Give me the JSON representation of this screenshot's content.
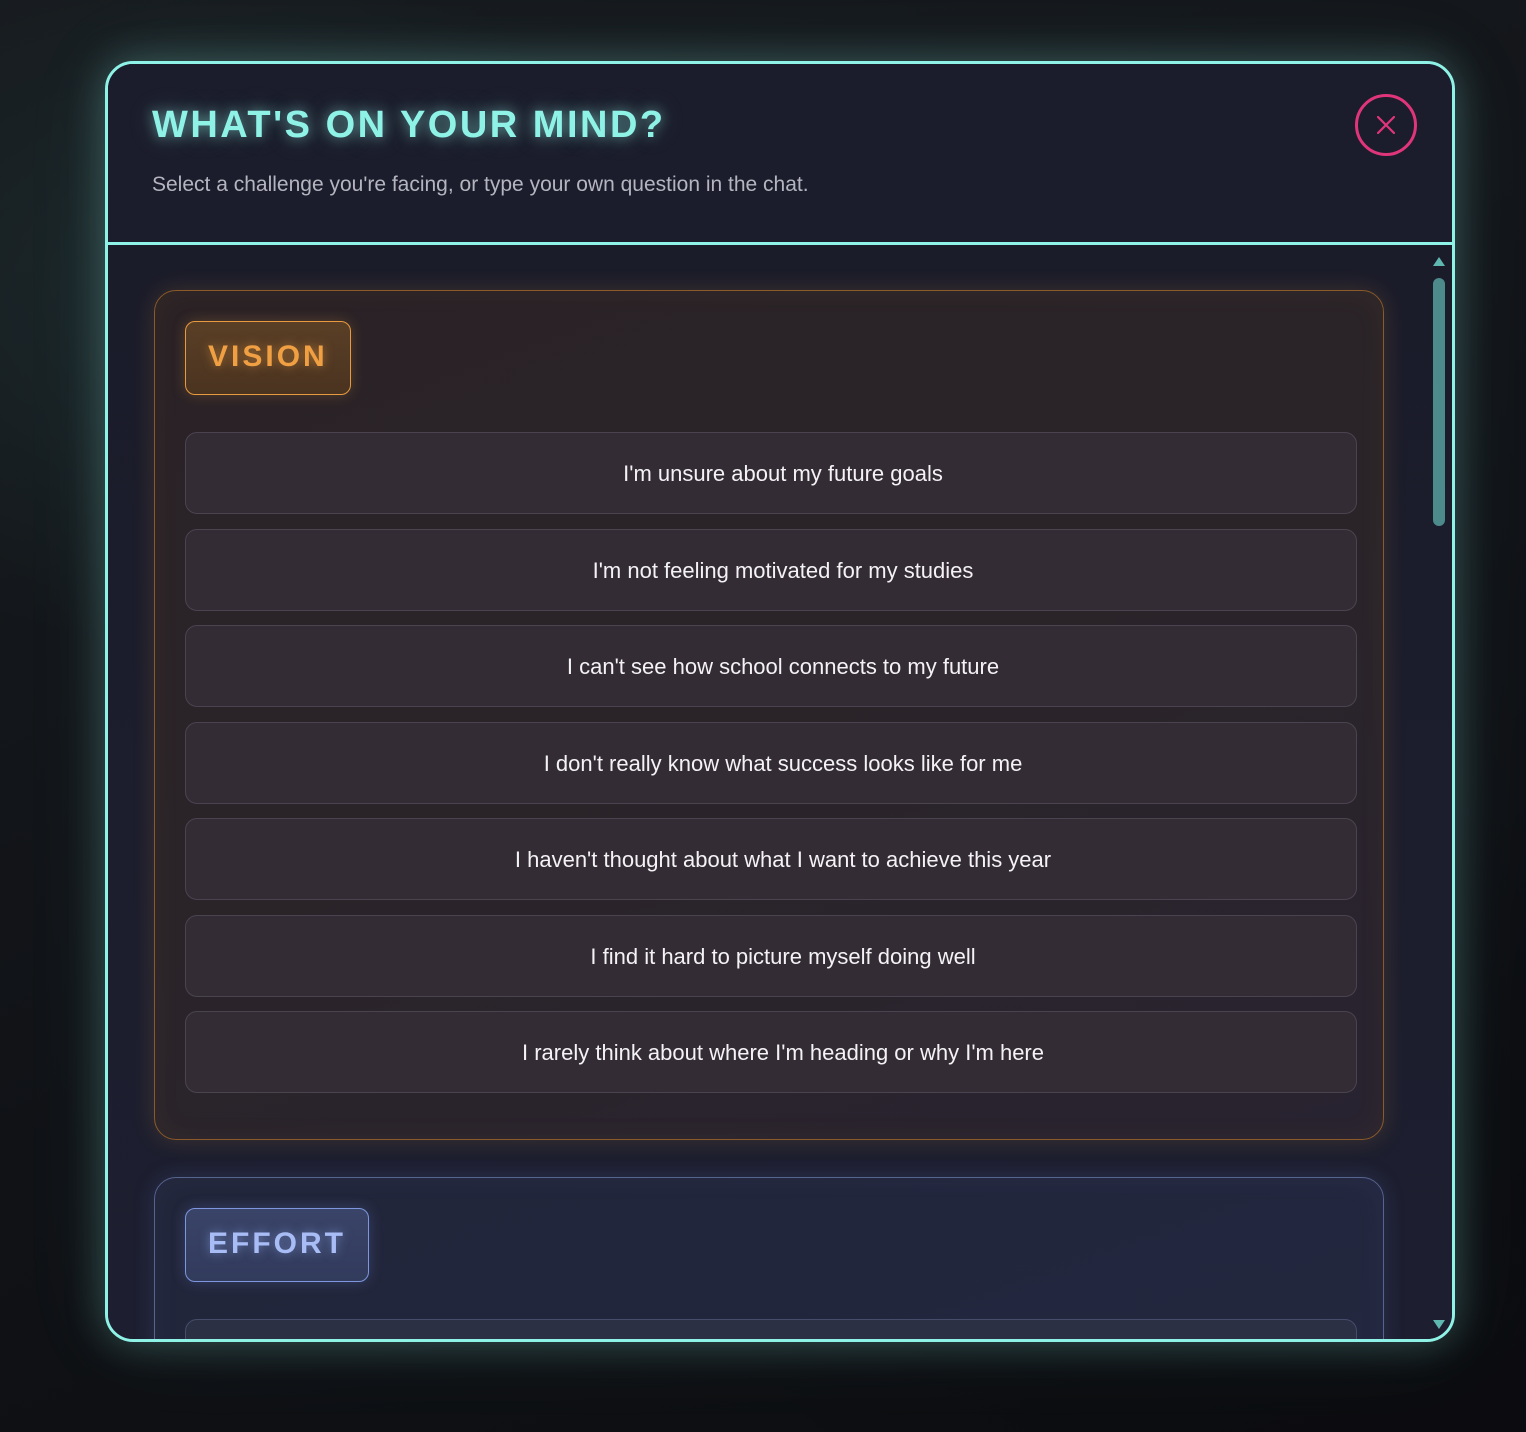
{
  "modal": {
    "title": "WHAT'S ON YOUR MIND?",
    "subtitle": "Select a challenge you're facing, or type your own question in the chat.",
    "close_icon": "close-icon"
  },
  "colors": {
    "accent": "#8ff2e6",
    "close": "#e0357a",
    "vision": "#f0a043",
    "effort": "#a8bcf5"
  },
  "categories": [
    {
      "label": "VISION",
      "options": [
        "I'm unsure about my future goals",
        "I'm not feeling motivated for my studies",
        "I can't see how school connects to my future",
        "I don't really know what success looks like for me",
        "I haven't thought about what I want to achieve this year",
        "I find it hard to picture myself doing well",
        "I rarely think about where I'm heading or why I'm here"
      ]
    },
    {
      "label": "EFFORT",
      "options": []
    }
  ]
}
